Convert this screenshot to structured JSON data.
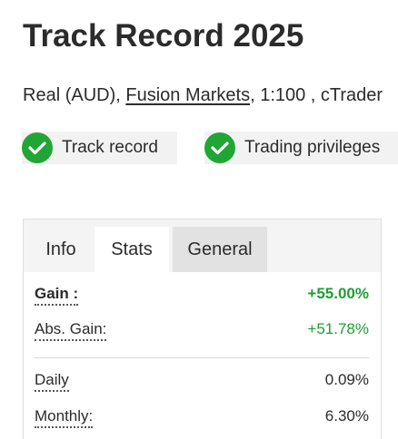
{
  "header": {
    "title": "Track Record 2025",
    "account_prefix": "Real (AUD), ",
    "broker_link": "Fusion Markets",
    "account_suffix": ", 1:100 , cTrader"
  },
  "badges": [
    {
      "label": "Track record",
      "icon": "check-circle-icon"
    },
    {
      "label": "Trading privileges",
      "icon": "check-circle-icon"
    }
  ],
  "tabs": [
    {
      "label": "Info",
      "active": false
    },
    {
      "label": "Stats",
      "active": true
    },
    {
      "label": "General",
      "active": false
    }
  ],
  "stats": [
    {
      "label": "Gain :",
      "value": "+55.00%"
    },
    {
      "label": "Abs. Gain:",
      "value": "+51.78%"
    },
    {
      "label": "Daily",
      "value": "0.09%"
    },
    {
      "label": "Monthly:",
      "value": "6.30%"
    }
  ],
  "colors": {
    "check_green": "#21a635",
    "positive_green": "#1e9e33",
    "badge_bg": "#f2f2f2",
    "inactive_tab_bg": "#e2e2e2"
  }
}
